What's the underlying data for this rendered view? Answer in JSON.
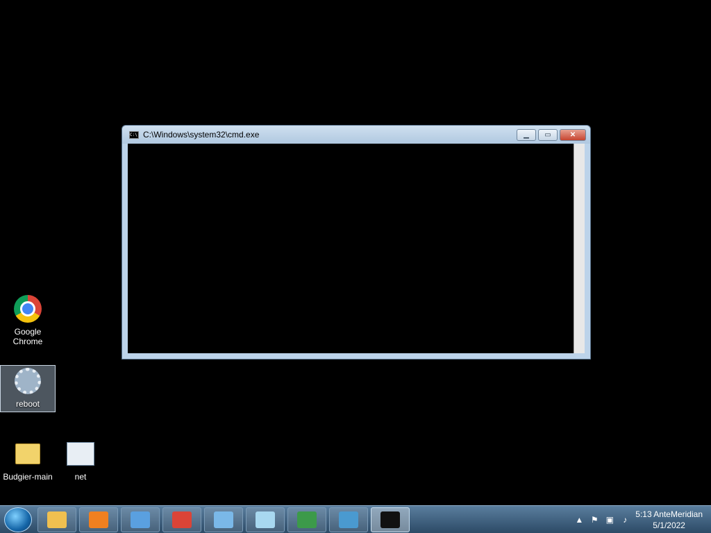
{
  "desktop_icons": {
    "chrome": "Google\nChrome",
    "reboot": "reboot",
    "budgier": "Budgier-main",
    "net": "net"
  },
  "cmd_window": {
    "title": "C:\\Windows\\system32\\cmd.exe",
    "minimize": "▁",
    "maximize": "▭",
    "close": "✕"
  },
  "taskbar": {
    "items": [
      {
        "name": "explorer",
        "color": "#f0c050"
      },
      {
        "name": "media-player",
        "color": "#f08020"
      },
      {
        "name": "control-panel",
        "color": "#5aa0e0"
      },
      {
        "name": "chrome",
        "color": "#db4437"
      },
      {
        "name": "picture-viewer",
        "color": "#7ab8e8"
      },
      {
        "name": "notepad",
        "color": "#a8d8f0"
      },
      {
        "name": "task-manager",
        "color": "#3c9a4a"
      },
      {
        "name": "registry-editor",
        "color": "#4a9ad0"
      },
      {
        "name": "cmd",
        "color": "#111111"
      }
    ],
    "clock_time": "5:13 AnteMeridian",
    "clock_date": "5/1/2022"
  }
}
